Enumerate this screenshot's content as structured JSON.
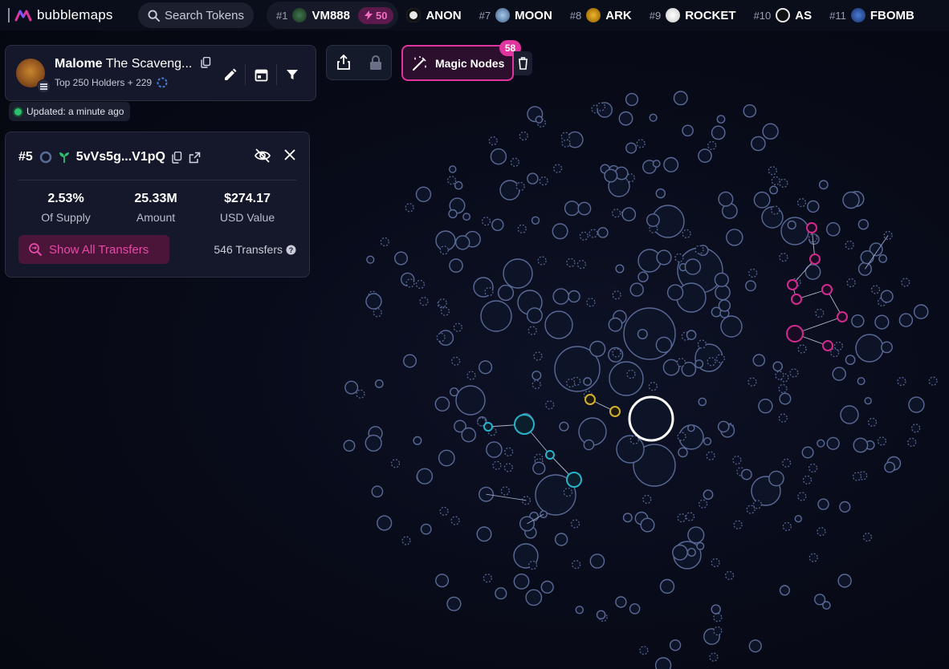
{
  "app": {
    "brand": "bubblemaps",
    "search_placeholder": "Search Tokens"
  },
  "ticker": [
    {
      "rank": "#1",
      "symbol": "VM888",
      "icon": "vm888-token-icon",
      "boost": "50"
    },
    {
      "rank": "",
      "symbol": "ANON",
      "icon": "anon-token-icon"
    },
    {
      "rank": "#7",
      "symbol": "MOON",
      "icon": "moon-token-icon"
    },
    {
      "rank": "#8",
      "symbol": "ARK",
      "icon": "ark-token-icon"
    },
    {
      "rank": "#9",
      "symbol": "ROCKET",
      "icon": "rocket-token-icon"
    },
    {
      "rank": "#10",
      "symbol": "AS",
      "icon": "as-token-icon"
    },
    {
      "rank": "#11",
      "symbol": "FBOMB",
      "icon": "fbomb-token-icon"
    }
  ],
  "token": {
    "name": "Malome",
    "subtitle": "The Scaveng...",
    "holders_label": "Top 250 Holders + 229",
    "updated": "Updated: a minute ago"
  },
  "toolbar": {
    "magic_nodes_label": "Magic Nodes",
    "magic_nodes_count": "58"
  },
  "holder": {
    "rank": "#5",
    "address": "5vVs5g...V1pQ",
    "stats": [
      {
        "value": "2.53%",
        "label": "Of Supply"
      },
      {
        "value": "25.33M",
        "label": "Amount"
      },
      {
        "value": "$274.17",
        "label": "USD Value"
      }
    ],
    "show_transfers_label": "Show All Transfers",
    "transfers_count": "546 Transfers"
  },
  "colors": {
    "accent": "#e0359e",
    "node_stroke": "#5a6a96",
    "cluster_pink": "#d42a8f",
    "cluster_cyan": "#27b3c9",
    "cluster_yellow": "#d4b12a",
    "selected": "#ffffff"
  }
}
